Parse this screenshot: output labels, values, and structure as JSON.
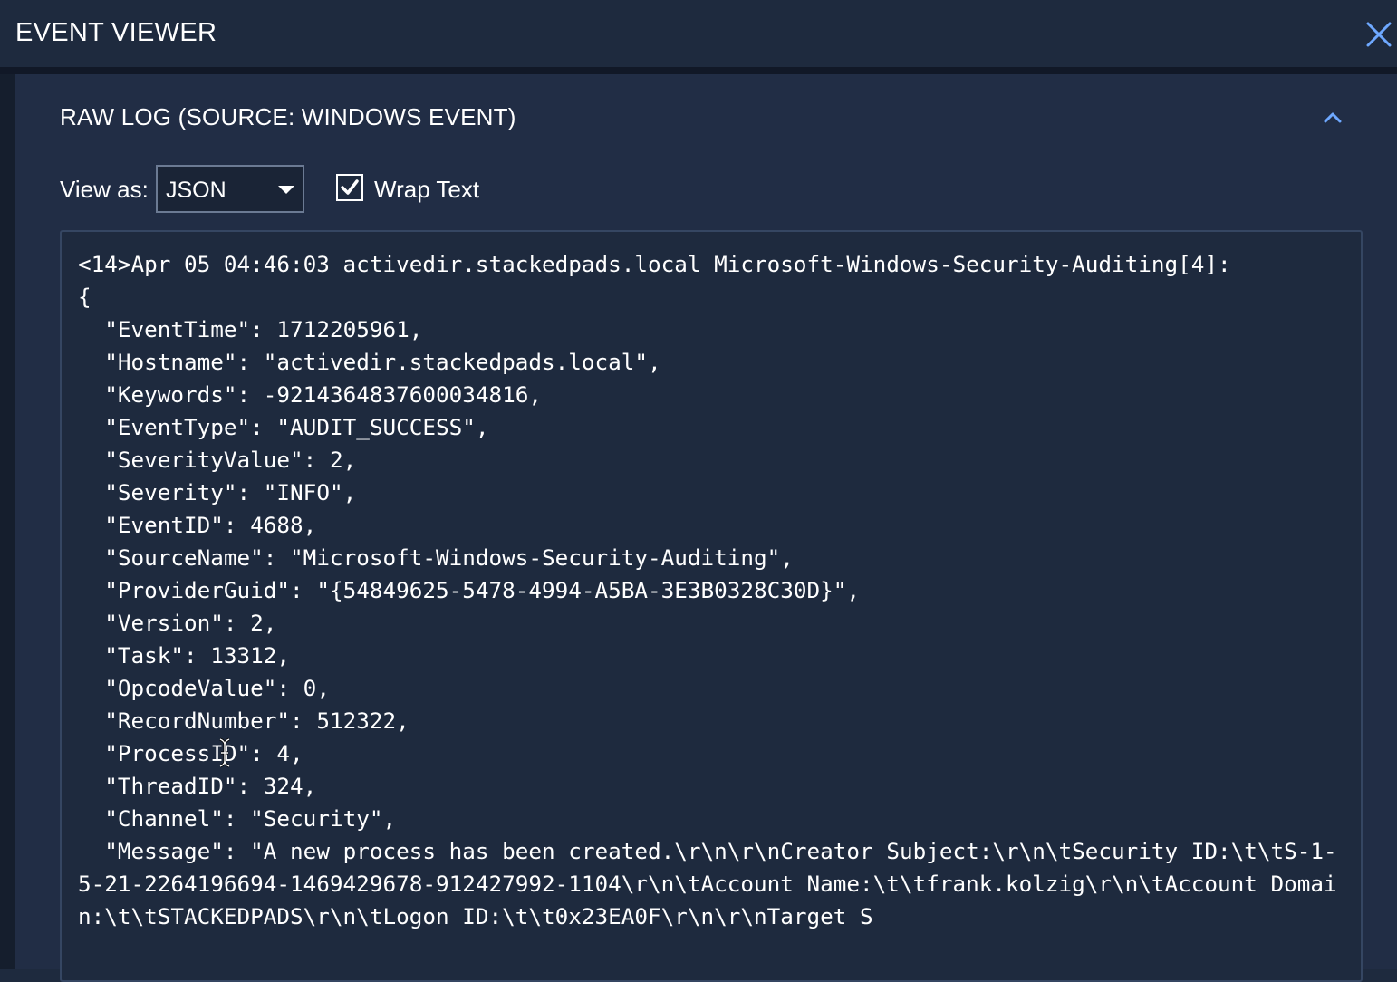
{
  "header": {
    "title": "EVENT VIEWER"
  },
  "icons": {
    "close": "close-icon",
    "collapse": "chevron-up-icon",
    "checkbox": "checkmark-icon",
    "caret": "caret-down-icon"
  },
  "section": {
    "title": "RAW LOG (SOURCE: WINDOWS EVENT)"
  },
  "controls": {
    "view_as_label": "View as:",
    "view_as_value": "JSON",
    "wrap_text_label": "Wrap Text",
    "wrap_text_checked": true
  },
  "colors": {
    "background": "#1e2a3e",
    "panel": "#212d45",
    "accent": "#6ea8ff",
    "text": "#ffffff"
  },
  "raw_log": "<14>Apr 05 04:46:03 activedir.stackedpads.local Microsoft-Windows-Security-Auditing[4]:\n{\n  \"EventTime\": 1712205961,\n  \"Hostname\": \"activedir.stackedpads.local\",\n  \"Keywords\": -9214364837600034816,\n  \"EventType\": \"AUDIT_SUCCESS\",\n  \"SeverityValue\": 2,\n  \"Severity\": \"INFO\",\n  \"EventID\": 4688,\n  \"SourceName\": \"Microsoft-Windows-Security-Auditing\",\n  \"ProviderGuid\": \"{54849625-5478-4994-A5BA-3E3B0328C30D}\",\n  \"Version\": 2,\n  \"Task\": 13312,\n  \"OpcodeValue\": 0,\n  \"RecordNumber\": 512322,\n  \"ProcessID\": 4,\n  \"ThreadID\": 324,\n  \"Channel\": \"Security\",\n  \"Message\": \"A new process has been created.\\r\\n\\r\\nCreator Subject:\\r\\n\\tSecurity ID:\\t\\tS-1-5-21-2264196694-1469429678-912427992-1104\\r\\n\\tAccount Name:\\t\\tfrank.kolzig\\r\\n\\tAccount Domain:\\t\\tSTACKEDPADS\\r\\n\\tLogon ID:\\t\\t0x23EA0F\\r\\n\\r\\nTarget S"
}
